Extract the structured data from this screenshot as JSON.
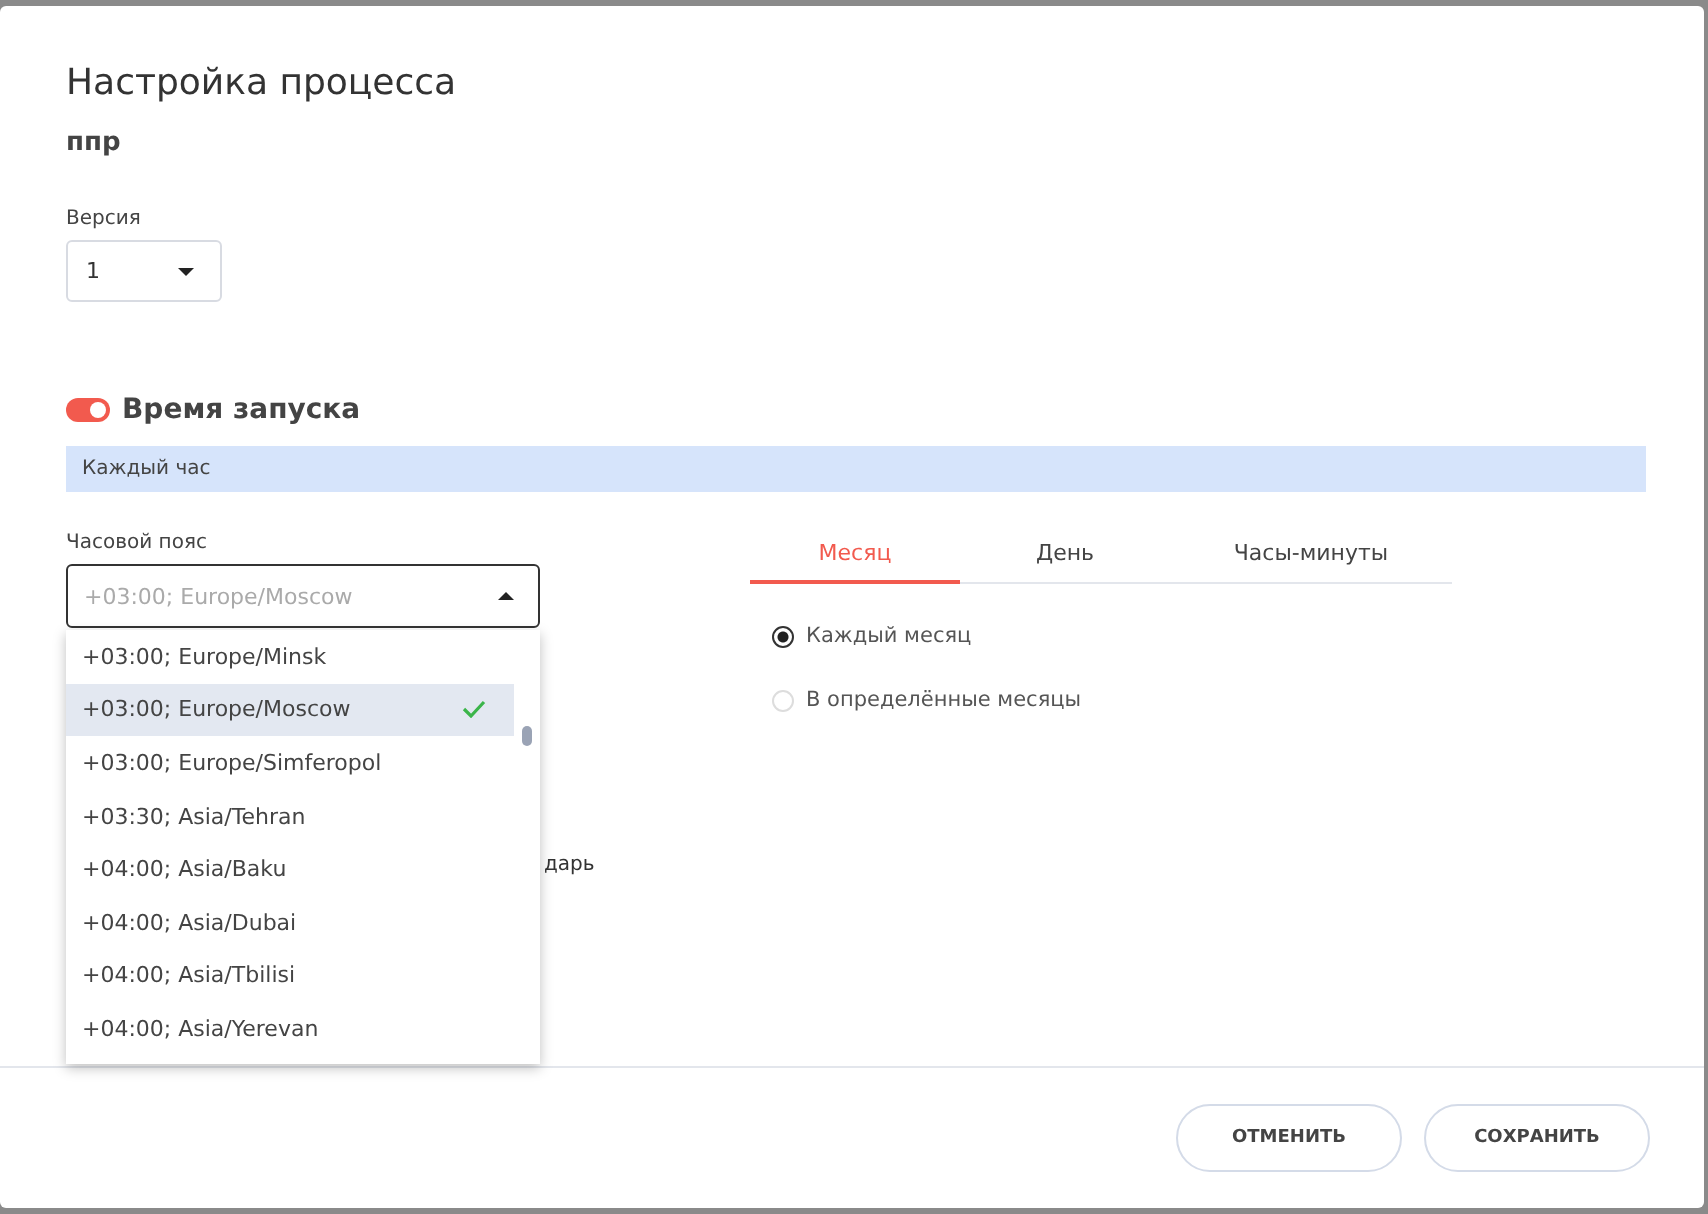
{
  "dialog": {
    "title": "Настройка процесса",
    "subtitle": "ппр",
    "version": {
      "label": "Версия",
      "value": "1"
    },
    "launch": {
      "label": "Время запуска",
      "on": true
    },
    "summary": "Каждый час",
    "timezone": {
      "label": "Часовой пояс",
      "placeholder": "+03:00; Europe/Moscow",
      "expanded": true,
      "options": [
        {
          "label": "+03:00; Europe/Minsk",
          "selected": false
        },
        {
          "label": "+03:00; Europe/Moscow",
          "selected": true
        },
        {
          "label": "+03:00; Europe/Simferopol",
          "selected": false
        },
        {
          "label": "+03:30; Asia/Tehran",
          "selected": false
        },
        {
          "label": "+04:00; Asia/Baku",
          "selected": false
        },
        {
          "label": "+04:00; Asia/Dubai",
          "selected": false
        },
        {
          "label": "+04:00; Asia/Tbilisi",
          "selected": false
        },
        {
          "label": "+04:00; Asia/Yerevan",
          "selected": false
        }
      ]
    },
    "covered_text": "дарь",
    "tabs": [
      {
        "label": "Месяц",
        "selected": true
      },
      {
        "label": "День",
        "selected": false
      },
      {
        "label": "Часы-минуты",
        "selected": false
      }
    ],
    "radios": [
      {
        "label": "Каждый месяц",
        "selected": true
      },
      {
        "label": "В определённые месяцы",
        "selected": false
      }
    ],
    "buttons": [
      "ОТМЕНИТЬ",
      "СОХРАНИТЬ"
    ]
  }
}
